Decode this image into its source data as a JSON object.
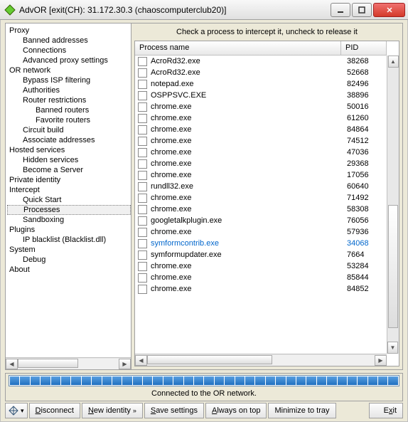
{
  "window": {
    "title": "AdvOR [exit(CH): 31.172.30.3 (chaoscomputerclub20)]"
  },
  "tree": [
    {
      "label": "Proxy",
      "level": 0
    },
    {
      "label": "Banned addresses",
      "level": 1
    },
    {
      "label": "Connections",
      "level": 1
    },
    {
      "label": "Advanced proxy settings",
      "level": 1
    },
    {
      "label": "OR network",
      "level": 0
    },
    {
      "label": "Bypass ISP filtering",
      "level": 1
    },
    {
      "label": "Authorities",
      "level": 1
    },
    {
      "label": "Router restrictions",
      "level": 1
    },
    {
      "label": "Banned routers",
      "level": 2
    },
    {
      "label": "Favorite routers",
      "level": 2
    },
    {
      "label": "Circuit build",
      "level": 1
    },
    {
      "label": "Associate addresses",
      "level": 1
    },
    {
      "label": "Hosted services",
      "level": 0
    },
    {
      "label": "Hidden services",
      "level": 1
    },
    {
      "label": "Become a Server",
      "level": 1
    },
    {
      "label": "Private identity",
      "level": 0
    },
    {
      "label": "Intercept",
      "level": 0
    },
    {
      "label": "Quick Start",
      "level": 1
    },
    {
      "label": "Processes",
      "level": 1,
      "selected": true
    },
    {
      "label": "Sandboxing",
      "level": 1
    },
    {
      "label": "Plugins",
      "level": 0
    },
    {
      "label": "IP blacklist (Blacklist.dll)",
      "level": 1
    },
    {
      "label": "System",
      "level": 0
    },
    {
      "label": "Debug",
      "level": 1
    },
    {
      "label": "About",
      "level": 0
    }
  ],
  "hint": "Check a process to intercept it, uncheck to release it",
  "columns": {
    "name": "Process name",
    "pid": "PID"
  },
  "processes": [
    {
      "name": "AcroRd32.exe",
      "pid": "38268"
    },
    {
      "name": "AcroRd32.exe",
      "pid": "52668"
    },
    {
      "name": "notepad.exe",
      "pid": "82496"
    },
    {
      "name": "OSPPSVC.EXE",
      "pid": "38896"
    },
    {
      "name": "chrome.exe",
      "pid": "50016"
    },
    {
      "name": "chrome.exe",
      "pid": "61260"
    },
    {
      "name": "chrome.exe",
      "pid": "84864"
    },
    {
      "name": "chrome.exe",
      "pid": "74512"
    },
    {
      "name": "chrome.exe",
      "pid": "47036"
    },
    {
      "name": "chrome.exe",
      "pid": "29368"
    },
    {
      "name": "chrome.exe",
      "pid": "17056"
    },
    {
      "name": "rundll32.exe",
      "pid": "60640"
    },
    {
      "name": "chrome.exe",
      "pid": "71492"
    },
    {
      "name": "chrome.exe",
      "pid": "58308"
    },
    {
      "name": "googletalkplugin.exe",
      "pid": "76056"
    },
    {
      "name": "chrome.exe",
      "pid": "57936"
    },
    {
      "name": "symformcontrib.exe",
      "pid": "34068",
      "special": true
    },
    {
      "name": "symformupdater.exe",
      "pid": "7664"
    },
    {
      "name": "chrome.exe",
      "pid": "53284"
    },
    {
      "name": "chrome.exe",
      "pid": "85844"
    },
    {
      "name": "chrome.exe",
      "pid": "84852"
    }
  ],
  "status": "Connected to the OR network.",
  "buttons": {
    "disconnect": "Disconnect",
    "new_identity": "New identity",
    "save": "Save settings",
    "ontop": "Always on top",
    "minimize": "Minimize to tray",
    "exit": "Exit"
  }
}
